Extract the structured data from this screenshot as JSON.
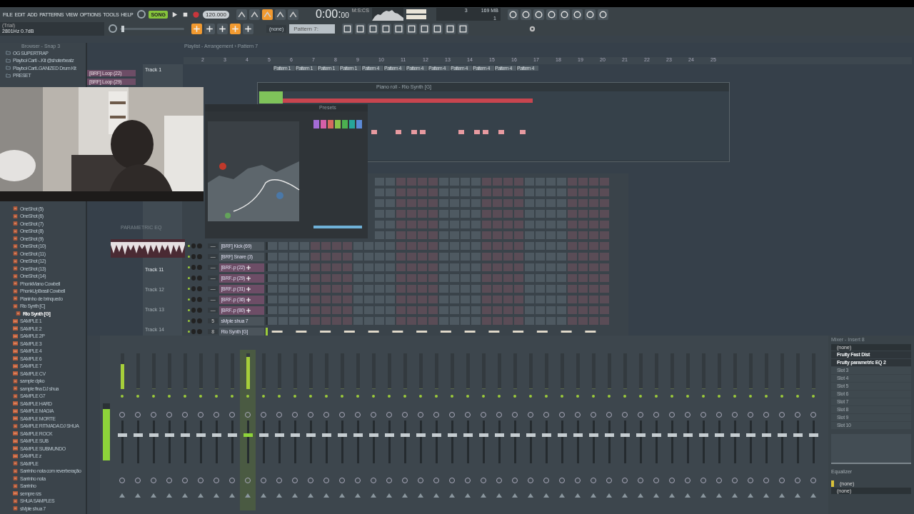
{
  "menu": [
    "FILE",
    "EDIT",
    "ADD",
    "PATTERNS",
    "VIEW",
    "OPTIONS",
    "TOOLS",
    "HELP"
  ],
  "hint": {
    "title": "(Trial)",
    "text": "2801Hz 0.7dB"
  },
  "transport": {
    "mode": "SONG",
    "song_mode": true,
    "tempo": "120.000",
    "time": "0:00:",
    "time_cs": "00",
    "time_unit": "M:S:CS",
    "cpu": "3",
    "memory": "169 MB",
    "polyphony": "1"
  },
  "pattern_bar": {
    "arrangement": "(none)",
    "pattern": "Pattern 7:"
  },
  "browser": {
    "title": "Browser - Snap 3",
    "items_top": [
      {
        "label": "OG SUPERTRAP",
        "kind": "folder",
        "selected": false
      },
      {
        "label": "Playboi Carti -..Kit @shoterbeatz",
        "kind": "folder",
        "selected": false
      },
      {
        "label": "Playboi Carti..GANIZED Drum Kit",
        "kind": "folder",
        "selected": false
      },
      {
        "label": "PRESET",
        "kind": "folder",
        "selected": false
      }
    ],
    "items": [
      {
        "label": "OneShot (5)",
        "kind": "file",
        "selected": false
      },
      {
        "label": "OneShot (6)",
        "kind": "file",
        "selected": false
      },
      {
        "label": "OneShot (7)",
        "kind": "file",
        "selected": false
      },
      {
        "label": "OneShot (8)",
        "kind": "file",
        "selected": false
      },
      {
        "label": "OneShot (9)",
        "kind": "file",
        "selected": false
      },
      {
        "label": "OneShot (10)",
        "kind": "file",
        "selected": false
      },
      {
        "label": "OneShot (11)",
        "kind": "file",
        "selected": false
      },
      {
        "label": "OneShot (12)",
        "kind": "file",
        "selected": false
      },
      {
        "label": "OneShot (13)",
        "kind": "file",
        "selected": false
      },
      {
        "label": "OneShot (14)",
        "kind": "file",
        "selected": false
      },
      {
        "label": "PhonkMano Cowbell",
        "kind": "file",
        "selected": false
      },
      {
        "label": "PhonkUpBrasil Cowbell",
        "kind": "file",
        "selected": false
      },
      {
        "label": "Pianinho de brinquedo",
        "kind": "file",
        "selected": false
      },
      {
        "label": "Rio Synth [C]",
        "kind": "file",
        "selected": false
      },
      {
        "label": "Rio Synth [G]",
        "kind": "file",
        "selected": true
      },
      {
        "label": "SAMPLE 1",
        "kind": "audio",
        "selected": false
      },
      {
        "label": "SAMPLE 2",
        "kind": "audio",
        "selected": false
      },
      {
        "label": "SAMPLE 2P",
        "kind": "audio",
        "selected": false
      },
      {
        "label": "SAMPLE 3",
        "kind": "audio",
        "selected": false
      },
      {
        "label": "SAMPLE 4",
        "kind": "audio",
        "selected": false
      },
      {
        "label": "SAMPLE 6",
        "kind": "audio",
        "selected": false
      },
      {
        "label": "SAMPLE 7",
        "kind": "audio",
        "selected": false
      },
      {
        "label": "SAMPLE CV",
        "kind": "audio",
        "selected": false
      },
      {
        "label": "sample dpko",
        "kind": "file",
        "selected": false
      },
      {
        "label": "sample fina DJ shua",
        "kind": "file",
        "selected": false
      },
      {
        "label": "SAMPLE G7",
        "kind": "file",
        "selected": false
      },
      {
        "label": "SAMPLE HARD",
        "kind": "audio",
        "selected": false
      },
      {
        "label": "SAMPLE MAGIA",
        "kind": "audio",
        "selected": false
      },
      {
        "label": "SAMPLE MORTE",
        "kind": "audio",
        "selected": false
      },
      {
        "label": "SAMPLE RITMADA DJ SHUA",
        "kind": "file",
        "selected": false
      },
      {
        "label": "SAMPLE ROCK",
        "kind": "audio",
        "selected": false
      },
      {
        "label": "SAMPLE SUB",
        "kind": "audio",
        "selected": false
      },
      {
        "label": "SAMPLE SUBMUNDO",
        "kind": "audio",
        "selected": false
      },
      {
        "label": "SAMPLE z",
        "kind": "audio",
        "selected": false
      },
      {
        "label": "SAMPLE",
        "kind": "file",
        "selected": false
      },
      {
        "label": "Sarrinho nota com reverberação",
        "kind": "file",
        "selected": false
      },
      {
        "label": "Sarrinho nota",
        "kind": "file",
        "selected": false
      },
      {
        "label": "Sarrinho",
        "kind": "file",
        "selected": false
      },
      {
        "label": "sempre rzs",
        "kind": "audio",
        "selected": false
      },
      {
        "label": "SHUA SAMPLES",
        "kind": "file",
        "selected": false
      },
      {
        "label": "sMple shua 7",
        "kind": "file",
        "selected": false
      }
    ]
  },
  "playlist": {
    "title": "Playlist - Arrangement › Pattern 7",
    "picker": [
      "[BRF] Loop (22)",
      "[BRF] Loop (29)"
    ],
    "bars": [
      "2",
      "3",
      "4",
      "5",
      "6",
      "7",
      "8",
      "9",
      "10",
      "11",
      "12",
      "13",
      "14",
      "15",
      "16",
      "17",
      "18",
      "19",
      "20",
      "21",
      "22",
      "23",
      "24",
      "25"
    ],
    "clips": [
      "Pattern 1",
      "Pattern 1",
      "Pattern 1",
      "Pattern 1",
      "Pattern 4",
      "Pattern 4",
      "Pattern 4",
      "Pattern 4",
      "Pattern 4",
      "Pattern 4",
      "Pattern 4",
      "Pattern 4"
    ],
    "tracks": [
      "Track 1",
      "Track 11",
      "Track 12",
      "Track 13",
      "Track 14"
    ]
  },
  "piano_roll": {
    "title": "Piano roll - Rio Synth [G]"
  },
  "plugin": {
    "title": "Presets",
    "label": "PARAMETRIC EQ"
  },
  "channel_rack": {
    "channels": [
      {
        "name": "[BRF] Kick (69)",
        "number": "—",
        "kind": "sampler",
        "selected": false
      },
      {
        "name": "[BRF] Snare (3)",
        "number": "—",
        "kind": "sampler",
        "selected": false
      },
      {
        "name": "[BRF..p (22)",
        "number": "—",
        "kind": "audio_clip",
        "selected": false
      },
      {
        "name": "[BRF..p (29)",
        "number": "—",
        "kind": "audio_clip",
        "selected": false
      },
      {
        "name": "[BRF..p (31)",
        "number": "—",
        "kind": "audio_clip",
        "selected": false
      },
      {
        "name": "[BRF..p (36)",
        "number": "—",
        "kind": "audio_clip",
        "selected": false
      },
      {
        "name": "[BRF..p (80)",
        "number": "—",
        "kind": "audio_clip",
        "selected": false
      },
      {
        "name": "sMple shua 7",
        "number": "5",
        "kind": "sampler",
        "selected": false
      },
      {
        "name": "Rio Synth [G]",
        "number": "8",
        "kind": "synth",
        "selected": true
      }
    ]
  },
  "master_pitch": {
    "level": 0.02
  },
  "mixer": {
    "main_meter": {
      "level": 0.9
    },
    "strips": [
      {
        "level": 0.7,
        "selected": false
      },
      {
        "level": 0,
        "selected": false
      },
      {
        "level": 0,
        "selected": false
      },
      {
        "level": 0,
        "selected": false
      },
      {
        "level": 0,
        "selected": false
      },
      {
        "level": 0,
        "selected": false
      },
      {
        "level": 0,
        "selected": false
      },
      {
        "level": 0,
        "selected": false
      },
      {
        "level": 0.9,
        "selected": true
      },
      {
        "level": 0,
        "selected": false
      },
      {
        "level": 0,
        "selected": false
      },
      {
        "level": 0,
        "selected": false
      },
      {
        "level": 0,
        "selected": false
      },
      {
        "level": 0,
        "selected": false
      },
      {
        "level": 0,
        "selected": false
      },
      {
        "level": 0,
        "selected": false
      },
      {
        "level": 0,
        "selected": false
      },
      {
        "level": 0,
        "selected": false
      },
      {
        "level": 0,
        "selected": false
      },
      {
        "level": 0,
        "selected": false
      },
      {
        "level": 0,
        "selected": false
      },
      {
        "level": 0,
        "selected": false
      },
      {
        "level": 0,
        "selected": false
      },
      {
        "level": 0,
        "selected": false
      },
      {
        "level": 0,
        "selected": false
      },
      {
        "level": 0,
        "selected": false
      },
      {
        "level": 0,
        "selected": false
      },
      {
        "level": 0,
        "selected": false
      },
      {
        "level": 0,
        "selected": false
      },
      {
        "level": 0,
        "selected": false
      },
      {
        "level": 0,
        "selected": false
      },
      {
        "level": 0,
        "selected": false
      },
      {
        "level": 0,
        "selected": false
      },
      {
        "level": 0,
        "selected": false
      },
      {
        "level": 0,
        "selected": false
      },
      {
        "level": 0,
        "selected": false
      },
      {
        "level": 0,
        "selected": false
      },
      {
        "level": 0,
        "selected": false
      },
      {
        "level": 0,
        "selected": false
      },
      {
        "level": 0,
        "selected": false
      },
      {
        "level": 0,
        "selected": false
      },
      {
        "level": 0,
        "selected": false
      },
      {
        "level": 0,
        "selected": false
      },
      {
        "level": 0,
        "selected": false
      },
      {
        "level": 0,
        "selected": false
      }
    ],
    "insert": {
      "title": "Mixer - Insert 8",
      "input": "(none)",
      "slots": [
        {
          "name": "Fruity Fast Dist",
          "active": true
        },
        {
          "name": "Fruity parametric EQ 2",
          "active": true
        },
        {
          "name": "Slot 3",
          "active": false
        },
        {
          "name": "Slot 4",
          "active": false
        },
        {
          "name": "Slot 5",
          "active": false
        },
        {
          "name": "Slot 6",
          "active": false
        },
        {
          "name": "Slot 7",
          "active": false
        },
        {
          "name": "Slot 8",
          "active": false
        },
        {
          "name": "Slot 9",
          "active": false
        },
        {
          "name": "Slot 10",
          "active": false
        }
      ],
      "eq_label": "Equalizer",
      "output_in": "(none)",
      "output_out": "(none)"
    }
  }
}
